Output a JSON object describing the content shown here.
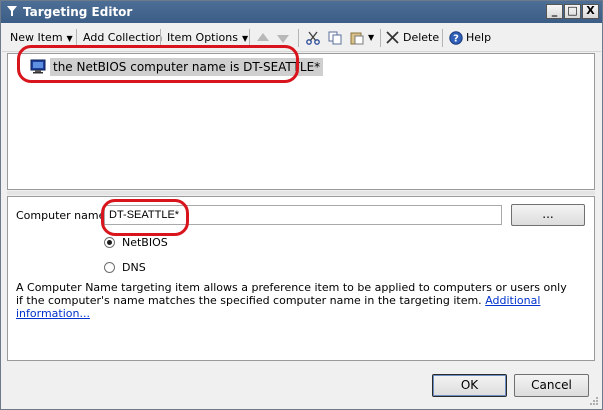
{
  "window": {
    "title": "Targeting Editor",
    "minimize_label": "_",
    "maximize_label": "□",
    "close_label": "X"
  },
  "toolbar": {
    "new_item": "New Item",
    "add_collection": "Add Collection",
    "item_options": "Item Options",
    "delete": "Delete",
    "help": "Help"
  },
  "tree": {
    "items": [
      {
        "label": "the NetBIOS computer name is DT-SEATTLE*"
      }
    ]
  },
  "properties": {
    "computer_name_label": "Computer name",
    "computer_name_value": "DT-SEATTLE*",
    "browse_label": "...",
    "radio_options": [
      {
        "label": "NetBIOS",
        "selected": true
      },
      {
        "label": "DNS",
        "selected": false
      }
    ],
    "description": "A Computer Name targeting item allows a preference item to be applied to computers or users only if the computer's name matches the specified computer name in the targeting item.",
    "link_text": "Additional information..."
  },
  "buttons": {
    "ok": "OK",
    "cancel": "Cancel"
  },
  "colors": {
    "titlebar": "#3b5d86",
    "highlight_oval": "#d8151c",
    "link": "#0033cc"
  }
}
